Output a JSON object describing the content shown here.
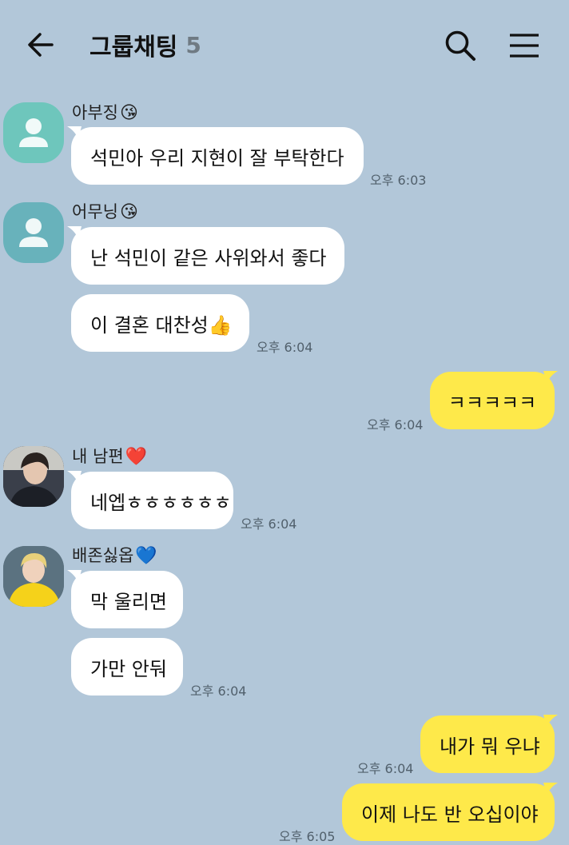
{
  "header": {
    "title": "그룹채팅",
    "member_count": "5",
    "icons": [
      "back-arrow-icon",
      "search-icon",
      "hamburger-menu-icon"
    ]
  },
  "colors": {
    "background": "#b2c7d9",
    "incoming_bubble": "#ffffff",
    "outgoing_bubble": "#fee94a"
  },
  "messages": [
    {
      "sender": "아부징",
      "sender_emoji": "😘",
      "avatar": "default-profile",
      "bubbles": [
        "석민아 우리 지현이 잘 부탁한다"
      ],
      "time": "오후 6:03"
    },
    {
      "sender": "어무닝",
      "sender_emoji": "😘",
      "avatar": "default-profile",
      "bubbles": [
        "난 석민이 같은 사위와서 좋다",
        "이 결혼 대찬성👍"
      ],
      "time": "오후 6:04"
    },
    {
      "sender": "me",
      "bubbles": [
        "ㅋㅋㅋㅋㅋ"
      ],
      "time": "오후 6:04"
    },
    {
      "sender": "내 남편",
      "sender_emoji": "❤️",
      "avatar": "photo",
      "bubbles": [
        "네엡ㅎㅎㅎㅎㅎㅎ"
      ],
      "time": "오후 6:04"
    },
    {
      "sender": "배존싫옵",
      "sender_emoji": "💙",
      "avatar": "photo",
      "bubbles": [
        "막 울리면",
        "가만 안둬"
      ],
      "time": "오후 6:04"
    },
    {
      "sender": "me",
      "bubbles": [
        "내가 뭐 우냐"
      ],
      "time": "오후 6:04"
    },
    {
      "sender": "me",
      "bubbles": [
        "이제 나도 반 오십이야"
      ],
      "time": "오후 6:05"
    }
  ]
}
